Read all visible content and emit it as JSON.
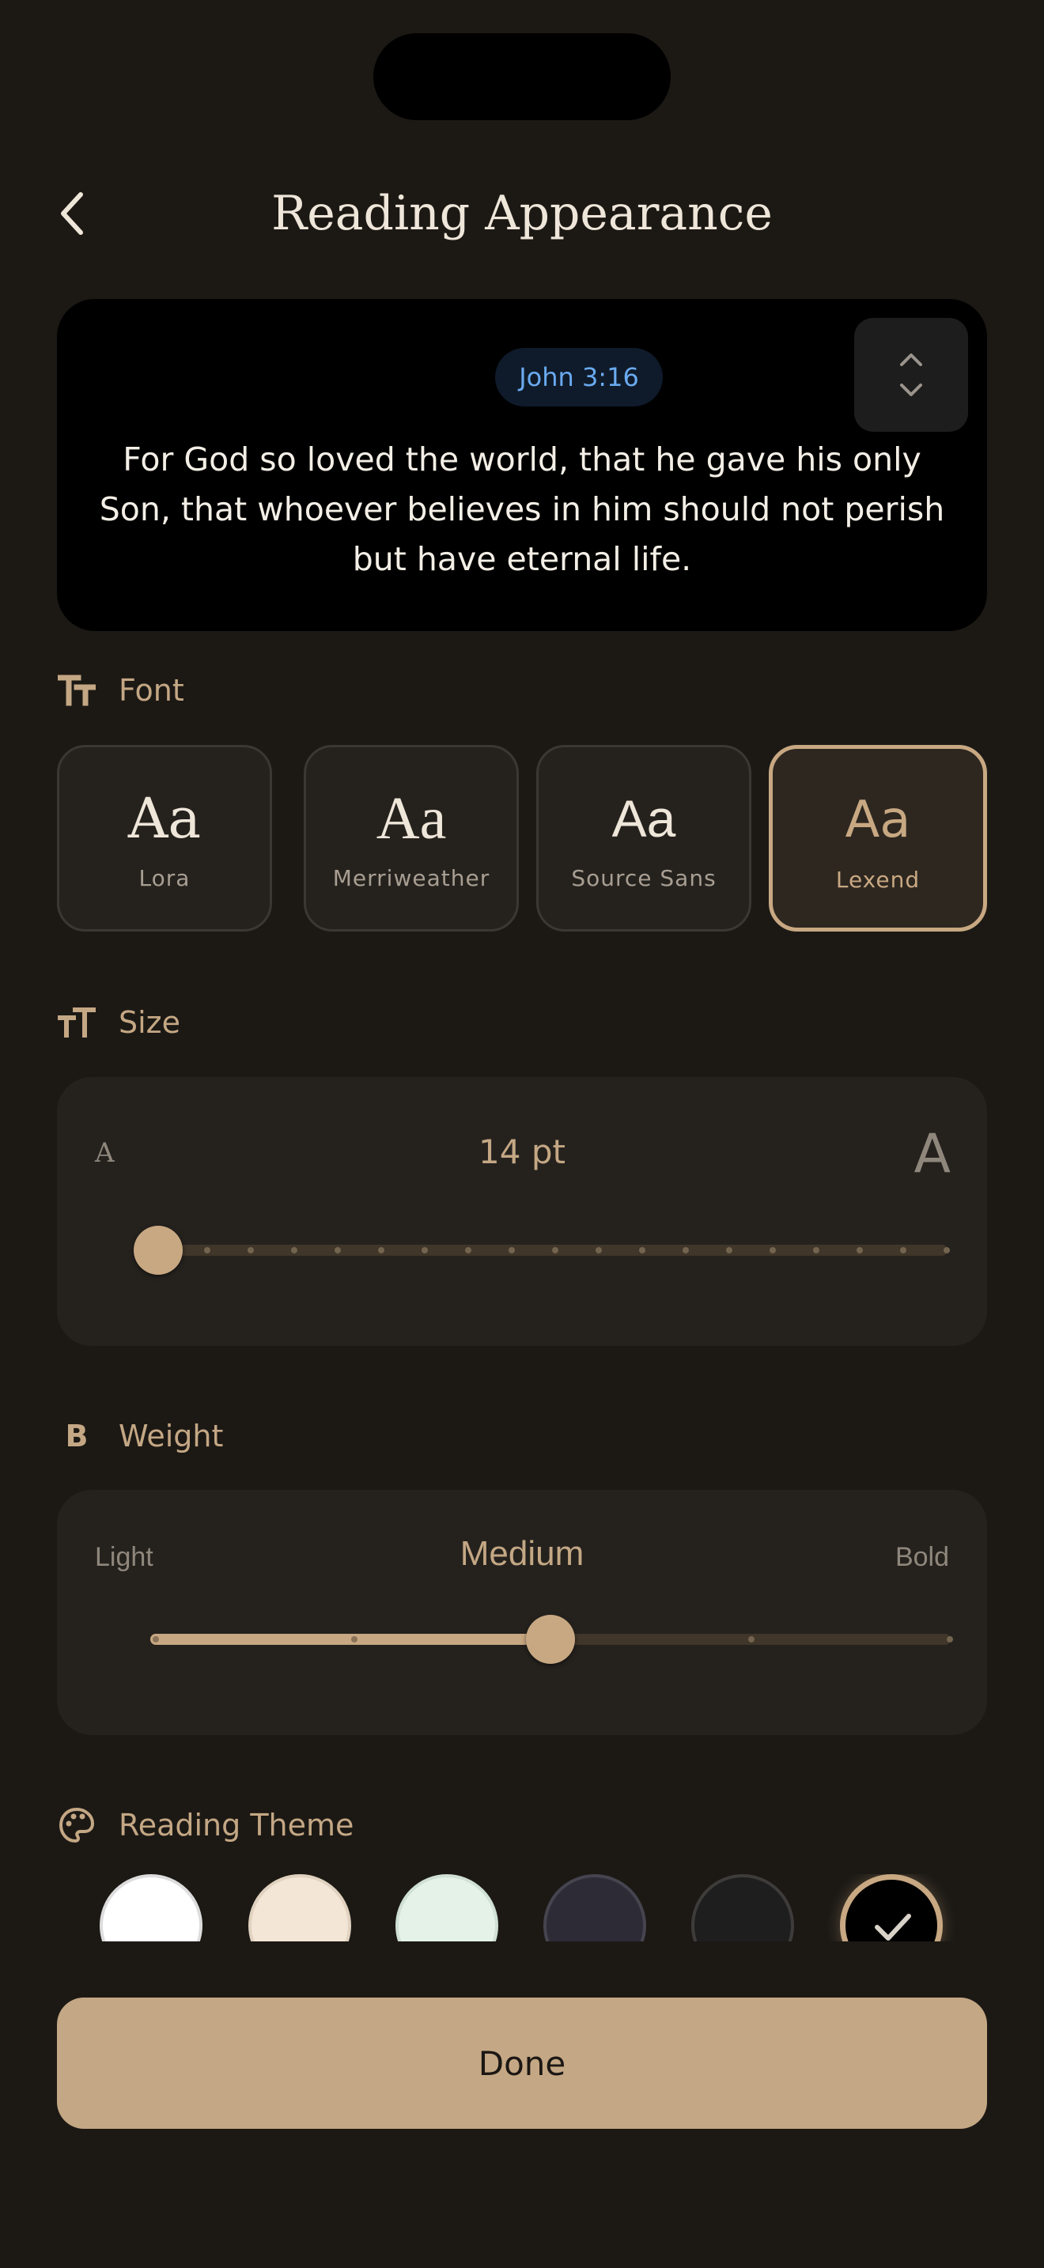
{
  "header": {
    "title": "Reading Appearance"
  },
  "preview": {
    "reference": "John 3:16",
    "verse": "For God so loved the world, that he gave his only Son, that whoever believes in him should not perish but have eternal life."
  },
  "font_section": {
    "label": "Font",
    "options": [
      {
        "sample": "Aa",
        "name": "Lora"
      },
      {
        "sample": "Aa",
        "name": "Merriweather"
      },
      {
        "sample": "Aa",
        "name": "Source Sans"
      },
      {
        "sample": "Aa",
        "name": "Lexend"
      }
    ],
    "selected": "Lexend"
  },
  "size_section": {
    "label": "Size",
    "small_glyph": "A",
    "large_glyph": "A",
    "value": "14 pt",
    "slider_fraction": 0.0,
    "steps": 19
  },
  "weight_section": {
    "label": "Weight",
    "min_label": "Light",
    "max_label": "Bold",
    "value": "Medium",
    "slider_fraction": 0.5,
    "steps": 5
  },
  "theme_section": {
    "label": "Reading Theme",
    "swatches": [
      {
        "color": "#ffffff",
        "border": "#dddddd",
        "selected": false
      },
      {
        "color": "#f3e6d6",
        "border": "#e0d2bf",
        "selected": false
      },
      {
        "color": "#e5f2e8",
        "border": "#d0e0d4",
        "selected": false
      },
      {
        "color": "#2c2b36",
        "border": "#45444f",
        "selected": false
      },
      {
        "color": "#1f1e1e",
        "border": "#3e3c3a",
        "selected": false
      },
      {
        "color": "#000000",
        "border": "#c8a882",
        "selected": true
      }
    ]
  },
  "done_label": "Done",
  "colors": {
    "accent": "#c4a784",
    "background": "#1c1915",
    "panel": "#25221e",
    "reference": "#6aaaf0"
  }
}
